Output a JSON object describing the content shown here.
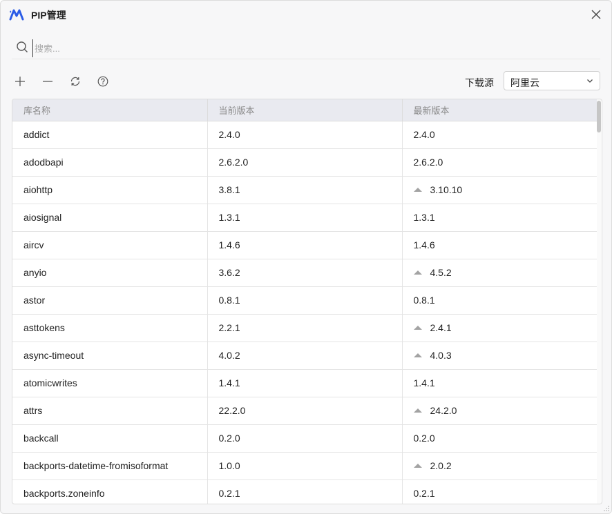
{
  "window": {
    "title": "PIP管理"
  },
  "search": {
    "placeholder": "搜索...",
    "value": ""
  },
  "toolbar": {
    "buttons": [
      {
        "icon": "plus-icon",
        "action": "add"
      },
      {
        "icon": "minus-icon",
        "action": "remove"
      },
      {
        "icon": "refresh-icon",
        "action": "refresh"
      },
      {
        "icon": "help-icon",
        "action": "help"
      }
    ],
    "source_label": "下载源",
    "source_value": "阿里云"
  },
  "table": {
    "columns": [
      "库名称",
      "当前版本",
      "最新版本"
    ],
    "rows": [
      {
        "name": "addict",
        "current": "2.4.0",
        "latest": "2.4.0",
        "upgradable": false
      },
      {
        "name": "adodbapi",
        "current": "2.6.2.0",
        "latest": "2.6.2.0",
        "upgradable": false
      },
      {
        "name": "aiohttp",
        "current": "3.8.1",
        "latest": "3.10.10",
        "upgradable": true
      },
      {
        "name": "aiosignal",
        "current": "1.3.1",
        "latest": "1.3.1",
        "upgradable": false
      },
      {
        "name": "aircv",
        "current": "1.4.6",
        "latest": "1.4.6",
        "upgradable": false
      },
      {
        "name": "anyio",
        "current": "3.6.2",
        "latest": "4.5.2",
        "upgradable": true
      },
      {
        "name": "astor",
        "current": "0.8.1",
        "latest": "0.8.1",
        "upgradable": false
      },
      {
        "name": "asttokens",
        "current": "2.2.1",
        "latest": "2.4.1",
        "upgradable": true
      },
      {
        "name": "async-timeout",
        "current": "4.0.2",
        "latest": "4.0.3",
        "upgradable": true
      },
      {
        "name": "atomicwrites",
        "current": "1.4.1",
        "latest": "1.4.1",
        "upgradable": false
      },
      {
        "name": "attrs",
        "current": "22.2.0",
        "latest": "24.2.0",
        "upgradable": true
      },
      {
        "name": "backcall",
        "current": "0.2.0",
        "latest": "0.2.0",
        "upgradable": false
      },
      {
        "name": "backports-datetime-fromisoformat",
        "current": "1.0.0",
        "latest": "2.0.2",
        "upgradable": true
      },
      {
        "name": "backports.zoneinfo",
        "current": "0.2.1",
        "latest": "0.2.1",
        "upgradable": false
      }
    ]
  },
  "colors": {
    "accent": "#2b5ce6",
    "header_bg": "#e9eaf0",
    "arrow": "#a3a3a3"
  }
}
